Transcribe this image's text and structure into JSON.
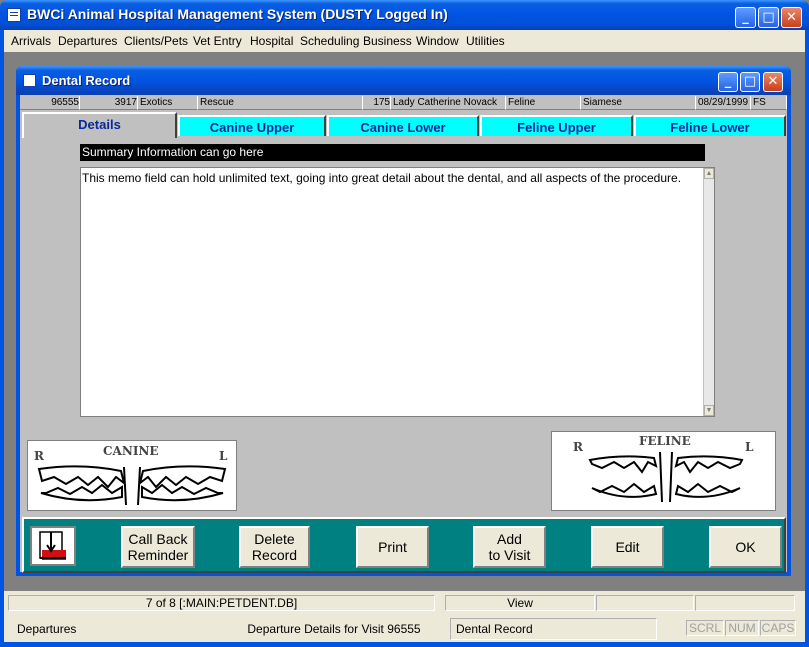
{
  "app": {
    "title": "BWCi Animal Hospital Management System (DUSTY Logged In)"
  },
  "menu": [
    "Arrivals",
    "Departures",
    "Clients/Pets",
    "Vet Entry",
    "Hospital",
    "Scheduling",
    "Business",
    "Window",
    "Utilities"
  ],
  "child": {
    "title": "Dental Record"
  },
  "info": {
    "visit": "96555",
    "client_num": "3917",
    "type": "Exotics",
    "status": "Rescue",
    "pet_num": "175",
    "pet_name": "Lady Catherine Novack",
    "species": "Feline",
    "breed": "Siamese",
    "birth_date": "08/29/1999",
    "sex": "FS"
  },
  "tabs": [
    "Details",
    "Canine Upper",
    "Canine Lower",
    "Feline Upper",
    "Feline Lower"
  ],
  "summary": "Summary Information can go here",
  "memo": "This memo field can hold unlimited text, going into great detail about the dental, and all aspects of the procedure.",
  "diagrams": {
    "canine": {
      "title": "CANINE",
      "right": "R",
      "left": "L"
    },
    "feline": {
      "title": "FELINE",
      "right": "R",
      "left": "L"
    }
  },
  "buttons": {
    "call_back_1": "Call Back",
    "call_back_2": "Reminder",
    "delete_1": "Delete",
    "delete_2": "Record",
    "print": "Print",
    "add_1": "Add",
    "add_2": "to Visit",
    "edit": "Edit",
    "ok": "OK"
  },
  "status": {
    "record": "7 of 8 [:MAIN:PETDENT.DB]",
    "mode": "View",
    "module": "Departures",
    "details": "Departure Details for Visit 96555",
    "form": "Dental Record",
    "scrl": "SCRL",
    "num": "NUM",
    "caps": "CAPS"
  },
  "icons": [
    "app-icon",
    "minimize-icon",
    "maximize-icon",
    "close-icon",
    "exit-door-icon"
  ],
  "colors": {
    "titlebar": "#0054e3",
    "tab": "#00ffff",
    "buttonbar": "#008080"
  }
}
